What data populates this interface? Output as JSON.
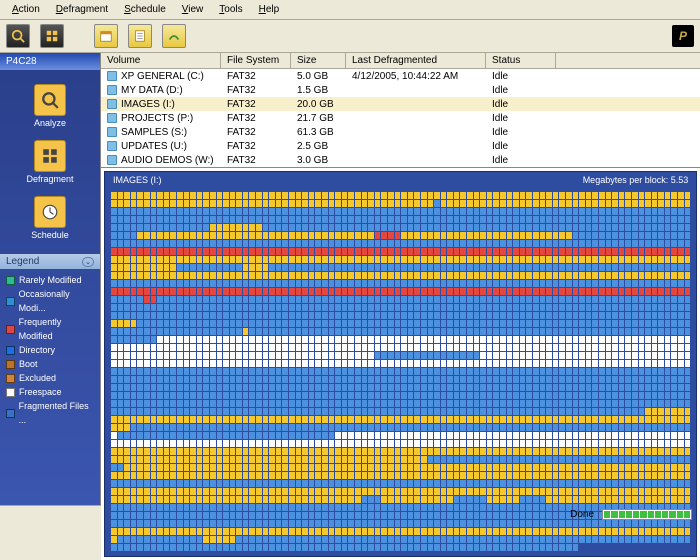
{
  "menu": {
    "action": "Action",
    "defrag": "Defragment",
    "schedule": "Schedule",
    "view": "View",
    "tools": "Tools",
    "help": "Help"
  },
  "sidebar": {
    "header": "P4C28",
    "buttons": [
      {
        "icon": "analyze",
        "label": "Analyze"
      },
      {
        "icon": "defrag",
        "label": "Defragment"
      },
      {
        "icon": "schedule",
        "label": "Schedule"
      }
    ]
  },
  "legend": {
    "title": "Legend",
    "items": [
      {
        "color": "#2bbf8f",
        "label": "Rarely Modified"
      },
      {
        "color": "#2e8fd6",
        "label": "Occasionally Modi..."
      },
      {
        "color": "#d94848",
        "label": "Frequently Modified"
      },
      {
        "color": "#1c6fe0",
        "label": "Directory"
      },
      {
        "color": "#b9752e",
        "label": "Boot"
      },
      {
        "color": "#d3833c",
        "label": "Excluded"
      },
      {
        "color": "#ffffff",
        "label": "Freespace"
      },
      {
        "color": "#3672c8",
        "label": "Fragmented Files ..."
      }
    ]
  },
  "volume_header": {
    "vol": "Volume",
    "fs": "File System",
    "size": "Size",
    "last": "Last Defragmented",
    "status": "Status"
  },
  "volumes": [
    {
      "name": "XP GENERAL (C:)",
      "fs": "FAT32",
      "size": "5.0 GB",
      "last": "4/12/2005, 10:44:22 AM",
      "status": "Idle",
      "sel": false
    },
    {
      "name": "MY DATA (D:)",
      "fs": "FAT32",
      "size": "1.5 GB",
      "last": "",
      "status": "Idle",
      "sel": false
    },
    {
      "name": "IMAGES (I:)",
      "fs": "FAT32",
      "size": "20.0 GB",
      "last": "",
      "status": "Idle",
      "sel": true
    },
    {
      "name": "PROJECTS (P:)",
      "fs": "FAT32",
      "size": "21.7 GB",
      "last": "",
      "status": "Idle",
      "sel": false
    },
    {
      "name": "SAMPLES (S:)",
      "fs": "FAT32",
      "size": "61.3 GB",
      "last": "",
      "status": "Idle",
      "sel": false
    },
    {
      "name": "UPDATES (U:)",
      "fs": "FAT32",
      "size": "2.5 GB",
      "last": "",
      "status": "Idle",
      "sel": false
    },
    {
      "name": "AUDIO DEMOS (W:)",
      "fs": "FAT32",
      "size": "3.0 GB",
      "last": "",
      "status": "Idle",
      "sel": false
    }
  ],
  "map": {
    "title": "IMAGES (I:)",
    "info": "Megabytes per block: 5.53"
  },
  "block_rows": [
    "YYYYYYYYYYYYYYYYYYYYYYYYYYYYYYYYYYYYYYYYYYYYYYYYYYYYYYYYYYYYYYYYYYYYYYYYYYYYYYYYYYYYYYYYYYYYYYYYYY",
    "YYYYYYYYYYYYYYYYYYYYYYYYYYYYYYYYYYYYYYYYYYYYYYYYYBYYYYYYYYYYYYYYYYYYYYYYYYYYYYYYYYYYYYYYYYYYYYYYYY",
    "BBBBBBBBBBBBBBBBBBBBBBBBBBBBBBBBBBBBBBBBBBBBBBBBBBBBBBBBBBBBBBBBBBBBBBBBBBBBBBBBBBBBBBBBBBBBBBBBBB",
    "BBBBBBBBBBBBBBBBBBBBBBBBBBBBBBBBBBBBBBBBBBBBBBBBBBBBBBBBBBBBBBBBBBBBBBBBBBBBBBBBBBBBBBBBBBBBBBBBBB",
    "BBBBBBBBBBBBBBBYYYYYYYYBBBBBBBBBBBBBBBBBBBBBBBBBBBBBBBBBBBBBBBBBBBBBBBBBBBBBBBBBBBBBBBBBBBBBBBYYYY",
    "BBBBYYYYYYYYYYYYYYYYYYYYYYYYYYYYYYYYYYYYRRRRYYYYYYYYYYYYYYYYYYYYYYYYYYBBBBBBBBBBBBBBBBBBBBBBBYYYYY",
    "BBBBBBBBBBBBBBBBBBBBBBBBBBBBBBBBBBBBBBBBBBBBBBBBBBBBBBBBBBBBBBBBBBBBBBBBBBBBBBBBBBBBBBBBBBBBBBBBBB",
    "RRRRRRRRRRRRRRRRRRRRRRRRRRRRRRRRRRRRRRRRRRRRRRRRRRRRRRRRRRRRRRRRRRRRRRRRRRRRRRRRRRRRRRRRRRRRRRRRRR",
    "YYYYYYYYYYYYYYYYYYYYYYYYYYYYYYYYYYYYYYYYYYYYYYYYYYYYYYYYYYYYYYYYYYYYYYYYYYYYYYYYYYYYYYYYYYYYYYYYYY",
    "YYYYYYYYYYBBBBBBBBBBYYYYBBBBBBBBBBBBBBBBBBBBBBBBBBBBBBBBBBBBBBBBBBBBBBBBBBBBBBBBBBBBBBBBBBBBBBBBYY",
    "YYYYYYYYYYYYYYYYYYYYYYYYYYYYYYYYYYYYYYYYYYYYYYYYYYYYYYYYYYYYYYYYYYYYYYYYYYYYYYYYYYYYYYYYYYYYYYYYYY",
    "BBBBBBBBBBBBBBBBBBBBBBBBBBBBBBBBBBBBBBBBBBBBBBBBBBBBBBBBBBBBBBBBBBBBBBBBBBBBBBBBBBBBBBBBBBBBBBBBBB",
    "RRRRRRRRRRRRRRRRRRRRRRRRRRRRRRRRRRRRRRRRRRRRRRRRRRRRRRRRRRRRRRRRRRRRRRRRRRRRRRRRRRRRRRRRRRRRRRRRRR",
    "BBBBBRRBBBBBBBBBBBBBBBBBBBBBBBBBBBBBBBBBBBBBBBBBBBBBBBBBBBBBBBBBBBBBBBBBBBBBBBBBBBBBBBBBBRRBBRRBBB",
    "BBBBBBBBBBBBBBBBBBBBBBBBBBBBBBBBBBBBBBBBBBBBBBBBBBBBBBBBBBBBBBBBBBBBBBBBBBBBBBBBBBBBBBBBBBBBBBBBBB",
    "BBBBBBBBBBBBBBBBBBBBBBBBBBBBBBBBBBBBBBBBBBBBBBBBBBBBBBBBBBBBBBBBBBBBBBBBBBBBBBBBBBBBBBBBBBBBBBBBBB",
    "YYYYBBBBBBBBBBBBBBBBBBBBBBBBBBBBBBBBBBBBBBBBBBBBBBBBBBBBBBBBBBBBBBBBBBBBBBBBBBBBBBBBBBBBBBBBBBBBBB",
    "BBBBBBBBBBBBBBBBBBBBYBBBBBBBBBBBBBBBBBBBBBBBBBBBBBBBBBBBBBBBBBBBBBBBBBBBBBBBBBBBBBBBBBBBBBBBBBBBBB",
    "BBBBBBBWWWWWWWWWWWWWWWWWWWWWWWWWWWWWWWWWWWWWWWWWWWWWWWWWWWWWWWWWWWWWWWWWWWWWWWWWWWWWWWWWWWWWWWWWWW",
    "WWWWWWWWWWWWWWWWWWWWWWWWWWWWWWWWWWWWWWWWWWWWWWWWWWWWWWWWWWWWWWWWWWWWWWWWWWWWWWWWWWWWWWWWWWWWWWWWWW",
    "WWWWWWWWWWWWWWWWWWWWWWWWWWWWWWWWWWWWWWWWBBBBBBBBBBBBBBBBWWWWWWWWWWWWWWWWWWWWWWWWWWWWWWWWWWWWWWWWWW",
    "WWWWWWWWWWWWWWWWWWWWWWWWWWWWWWWWWWWWWWWWWWWWWWWWWWWWWWWWWWWWWWWWWWWWWWWWWWWWWWWWWWWWWWWWWWWWWWWWWW",
    "BBBBBBBBBBBBBBBBBBBBBBBBBBBBBBBBBBBBBBBBBBBBBBBBBBBBBBBBBBBBBBBBBBBBBBBBBBBBBBBBBBBBBBBBBBBBBBBBBB",
    "BBBBBBBBBBBBBBBBBBBBBBBBBBBBBBBBBBBBBBBBBBBBBBBBBBBBBBBBBBBBBBBBBBBBBBBBBBBBBBBBBBBBBBBBBBBBBBBBBB",
    "BBBBBBBBBBBBBBBBBBBBBBBBBBBBBBBBBBBBBBBBBBBBBBBBBBBBBBBBBBBBBBBBBBBBBBBBBBBBBBBBBBBBBBBBBBBBBBBBBB",
    "BBBBBBBBBBBBBBBBBBBBBBBBBBBBBBBBBBBBBBBBBBBBBBBBBBBBBBBBBBBBBBBBBBBBBBBBBBBBBBBBBBBBBBBBBBBBBBBBBB",
    "BBBBBBBBBBBBBBBBBBBBBBBBBBBBBBBBBBBBBBBBBBBBBBBBBBBBBBBBBBBBBBBBBBBBBBBBBBBBBBBBBBBBBBBBBBBBBBBBBB",
    "BBBBBBBBBBBBBBBBBBBBBBBBBBBBBBBBBBBBBBBBBBBBBBBBBBBBBBBBBBBBBBBBBBBBBBBBBBBBBBBBBYYYYYYYYYYYYYYYYY",
    "YYYYYYYYYYYYYYYYYYYYYYYYYYYYYYYYYYYYYYYYYYYYYYYYYYYYYYYYYYYYYYYYYYYYYYYYYYYYYYYYYYYYYYYYYYYYYYYYYY",
    "YYYBBBBBBBBBBBBBBBBBBBBBBBBBBBBBBBBBBBBBBBBBBBBBBBBBBBBBBBBBBBBBBBBBBBBBBBBBBBBBBBBBBBBBBBBBBBBBBB",
    "WBBBBBBBBBBBBBBBBBBBBBBBBBBBBBBBBBWWWWWWWWWWWWWWWWWWWWWWWWWWWWWWWWWWWWWWWWWWWWWWWWWWWWWWWWWWWWWWWW",
    "WWWWWWWWWWWWWWWWWWWWWWWWWWWWWWWWWWWWWWWWWWWWWWWWWWWWWWWWWWWWWWWWWWWWWWWWWWWWWWWWWWWWWWWWWWWWWWWWWW",
    "YYYYYYYYYYYYYYYYYYYYYYYYYYYYYYYYYYYYYYYYYYYYYYYYYYYYYYYYYYYYYYYYYYYYYYYYYYYYYYYYYYYYYYYYYYYYYYYYYY",
    "YYYYYYYYYYYYYYYYYYYYYYYYYYYYYYYYYYYYYYYYYYYYYYYYBBBBBBBBBBBBBBBBBBBBBBBBBBBBBBBBBBBBBBBBBBBBBBBBBB",
    "BBYYYYYYYYYYYYYYYYYYYYYYYYYYYYYYYYYYYYYYYYYYYYYYYYYYYYYYYYYYYYYYYYYYYYYYYYYYYYYYYYYYYYYYYYYYYYYYYY",
    "YYYYYYYYYYYYYYYYYYYYYYYYYYYYYYYYYYYYYYYYYYYYYYYYYYYYYYYYYYYYYYYYYYYYYYYYYYYYYYYYYYYYYYYYYYYYYYYYYY",
    "BBBBBBBBBBBBBBBBBBBBBBBBBBBBBBBBBBBBBBBBBBBBBBBBBBBBBBBBBBBBBBBBBBBBBBBBBBBBBBBBBBBBBBBBBBBBBBBBBB",
    "YYYYYYYYYYYYYYYYYYYYYYYYYYYYYYYYYYYYYYYYYYYYYYYYYYYYYYYYYYYYYYYYYYYYYYYYYYYYYYYYYYYYYYYYYYYYYYYYYY",
    "YYYYYYYYYYYYYYYYYYYYYYYYYYYYYYYYYYYYYYBBBYYYYYYYYYYYBBBBBYYYYYBBBBYYYYYYYYYYYYYYYYYYYYYYYYYYYYYYYY",
    "BBBBBBBBBBBBBBBBBBBBBBBBBBBBBBBBBBBBBBBBBBBBBBBBBBBBBBBBBBBBBBBBBBBBBBBBBBBBBBBBBBBBBBBBBBBBBBBBBB",
    "BBBBBBBBBBBBBBBBBBBBBBBBBBBBBBBBBBBBBBBBBBBBBBBBBBBBBBBBBBBBBBBBBBBBBBBBBBBBBBBBBBBBBBBBBBBBBBBBBB",
    "BBBBBBBBBBBBBBBBBBBBBBBBBBBBBBBBBBBBBBBBBBBBBBBBBBBBBBBBBBBBBBBBBBBBBBBBBBBBBBBBBBBBBBBBBBBBBBBBBB",
    "YYYYYYYYYYYYYYYYYYYYYYYYYYYYYYYYYYYYYYYYYYYYYYYYYYYYYYYYYYYYYYYYYYYYYYYYYYYYYYYYYYYYYYYYYYYYYYYYYY",
    "YBBBBBBBBBBBBBYYYYYBBBBBBBBBBBBBBBBBBBBBBBBBBBBBBBBBBBBBBBBBBBBBBBBBBBBBBBBBBBBBBBBBBBBBBBBBBYYYYY",
    "BBBBBBBBBBBBBBBBBBBBBBBBBBBBBBBBBBBBBBBBBBBBBBBBBBBBBBBBBBBBBBBBBBBBBBBDDDDDDDDDDDDDDDDDDDDDDDDDDD"
  ],
  "status": {
    "label": "Done"
  }
}
